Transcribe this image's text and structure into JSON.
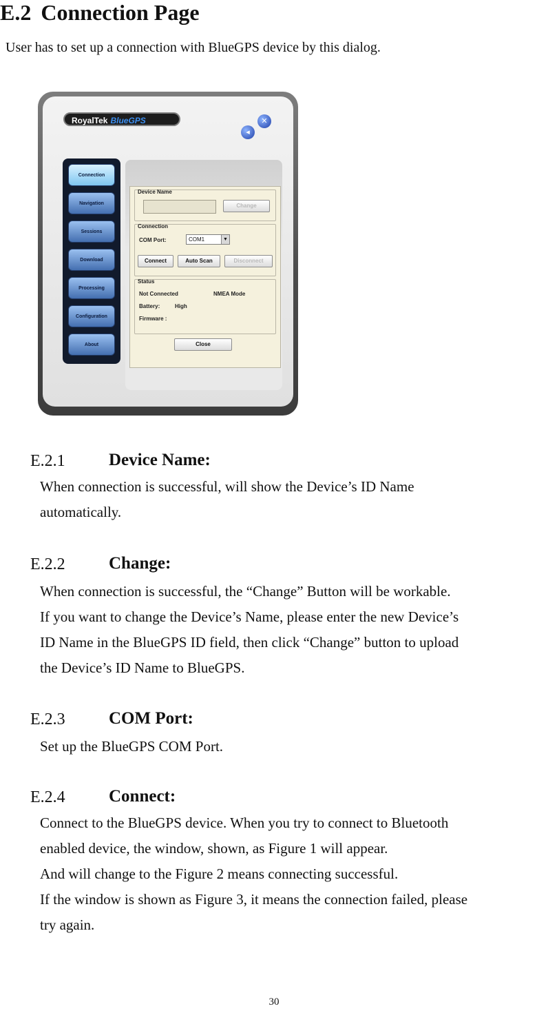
{
  "heading": {
    "number": "E.2",
    "title": "Connection Page"
  },
  "intro": "User has to set up a connection with BlueGPS device by this dialog.",
  "app": {
    "logo_brand": "RoyalTek",
    "logo_product": "BlueGPS",
    "nav_items": [
      "Connection",
      "Navigation",
      "Sessions",
      "Download",
      "Processing",
      "Configuration",
      "About"
    ],
    "device_name_group": "Device Name",
    "device_name_value": "",
    "change_button": "Change",
    "connection_group": "Connection",
    "com_port_label": "COM  Port:",
    "com_port_value": "COM1",
    "connect_button": "Connect",
    "auto_scan_button": "Auto Scan",
    "disconnect_button": "Disconnect",
    "status_group": "Status",
    "status_connection": "Not Connected",
    "status_mode": "NMEA Mode",
    "battery_label": "Battery:",
    "battery_value": "High",
    "firmware_label": "Firmware :",
    "close_button": "Close"
  },
  "sections": [
    {
      "number": "E.2.1",
      "title": "Device Name:",
      "lines": [
        "When connection is successful, will show the Device’s ID Name",
        "automatically."
      ]
    },
    {
      "number": "E.2.2",
      "title": "Change:",
      "lines": [
        "When connection is successful, the “Change” Button will be workable.",
        "If you want to change the Device’s Name, please enter the new Device’s",
        "ID Name in the BlueGPS ID field, then click “Change” button to upload",
        "the Device’s ID Name to BlueGPS."
      ]
    },
    {
      "number": "E.2.3",
      "title": "COM Port:",
      "lines": [
        "Set up the BlueGPS COM Port."
      ]
    },
    {
      "number": "E.2.4",
      "title": "Connect:",
      "lines": [
        "Connect to the BlueGPS device. When you try to connect to Bluetooth",
        "enabled device, the window, shown, as Figure 1 will appear.",
        "And will change to the Figure 2 means connecting successful.",
        "If the window is shown as Figure 3, it means the connection failed, please",
        "try again."
      ]
    }
  ],
  "page_number": "30"
}
